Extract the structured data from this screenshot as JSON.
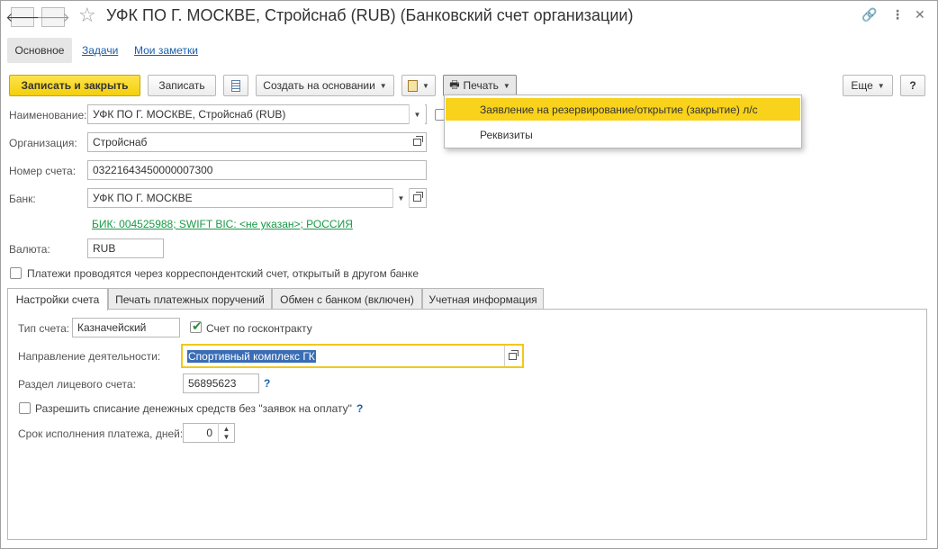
{
  "window": {
    "title": "УФК ПО Г. МОСКВЕ, Стройснаб (RUB) (Банковский счет организации)",
    "back_icon": "arrow-left-icon",
    "forward_icon": "arrow-right-icon",
    "star_icon": "star-icon",
    "link_icon": "link-icon",
    "more_icon": "kebab-icon",
    "close_icon": "close-icon"
  },
  "section_tabs": {
    "main": "Основное",
    "tasks": "Задачи",
    "notes": "Мои заметки"
  },
  "toolbar": {
    "save_close": "Записать и закрыть",
    "save": "Записать",
    "create_based": "Создать на основании",
    "print": "Печать",
    "more": "Еще",
    "help": "?"
  },
  "print_menu": {
    "items": [
      "Заявление на резервирование/открытие (закрытие) л/с",
      "Реквизиты"
    ]
  },
  "form": {
    "name_label": "Наименование:",
    "name_value": "УФК ПО Г. МОСКВЕ, Стройснаб (RUB)",
    "org_label": "Организация:",
    "org_value": "Стройснаб",
    "account_label": "Номер счета:",
    "account_value": "03221643450000007300",
    "bank_label": "Банк:",
    "bank_value": "УФК ПО Г. МОСКВЕ",
    "bank_details": "БИК: 004525988; SWIFT BIC: <не указан>; РОССИЯ",
    "currency_label": "Валюта:",
    "currency_value": "RUB",
    "corr_checkbox": "Платежи проводятся через корреспондентский счет, открытый в другом банке"
  },
  "tabs": [
    "Настройки счета",
    "Печать платежных поручений",
    "Обмен с банком (включен)",
    "Учетная информация"
  ],
  "settings": {
    "type_label": "Тип счета:",
    "type_value": "Казначейский",
    "gov_contract": "Счет по госконтракту",
    "direction_label": "Направление деятельности:",
    "direction_value": "Спортивный комплекс ГК",
    "section_label": "Раздел лицевого счета:",
    "section_value": "56895623",
    "allow_debit": "Разрешить списание денежных средств без \"заявок на оплату\"",
    "term_label": "Срок исполнения платежа, дней:",
    "term_value": "0",
    "help_mark": "?"
  }
}
